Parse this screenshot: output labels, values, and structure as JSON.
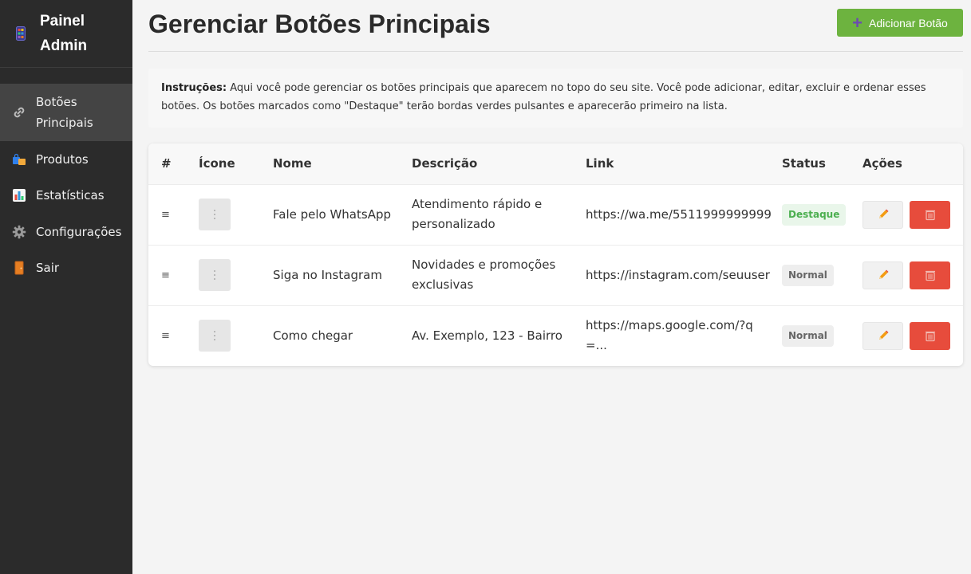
{
  "sidebar": {
    "brand": "Painel Admin",
    "items": [
      {
        "label": "Botões Principais",
        "icon": "link-icon",
        "active": true
      },
      {
        "label": "Produtos",
        "icon": "shopping-bags-icon"
      },
      {
        "label": "Estatísticas",
        "icon": "bar-chart-icon"
      },
      {
        "label": "Configurações",
        "icon": "gear-icon"
      },
      {
        "label": "Sair",
        "icon": "door-icon"
      }
    ]
  },
  "header": {
    "title": "Gerenciar Botões Principais",
    "add_button": "Adicionar Botão"
  },
  "instructions": {
    "label": "Instruções:",
    "text": "Aqui você pode gerenciar os botões principais que aparecem no topo do seu site. Você pode adicionar, editar, excluir e ordenar esses botões. Os botões marcados como \"Destaque\" terão bordas verdes pulsantes e aparecerão primeiro na lista."
  },
  "table": {
    "columns": [
      "#",
      "Ícone",
      "Nome",
      "Descrição",
      "Link",
      "Status",
      "Ações"
    ],
    "rows": [
      {
        "handle": "≡",
        "name": "Fale pelo WhatsApp",
        "description": "Atendimento rápido e personalizado",
        "link": "https://wa.me/5511999999999",
        "status": "Destaque"
      },
      {
        "handle": "≡",
        "name": "Siga no Instagram",
        "description": "Novidades e promoções exclusivas",
        "link": "https://instagram.com/seuuser",
        "status": "Normal"
      },
      {
        "handle": "≡",
        "name": "Como chegar",
        "description": "Av. Exemplo, 123 - Bairro",
        "link": "https://maps.google.com/?q=...",
        "status": "Normal"
      }
    ]
  },
  "colors": {
    "sidebar_bg": "#2b2b2b",
    "add_button": "#6db33f",
    "delete_button": "#e74c3c",
    "destaque_badge_text": "#4caf50"
  }
}
